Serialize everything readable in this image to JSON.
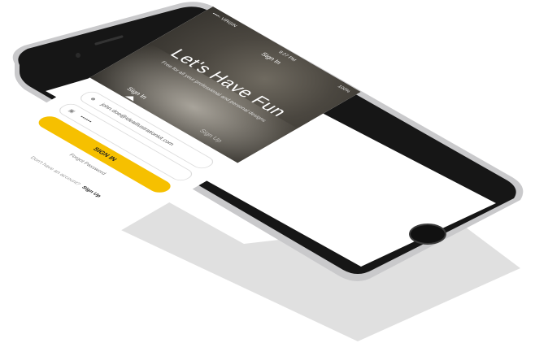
{
  "status_bar": {
    "carrier": "••••◦ VIRGIN",
    "time": "9:27 PM",
    "battery": "100%"
  },
  "nav": {
    "title": "Sign In"
  },
  "hero": {
    "headline": "Let's Have Fun",
    "subtitle": "Free for all your professional and personal designs"
  },
  "tabs": [
    {
      "label": "Sign In",
      "active": true
    },
    {
      "label": "Sign Up",
      "active": false
    }
  ],
  "form": {
    "email_value": "john.doe@ideaillustrationkit.com",
    "password_value": "••••••",
    "submit_label": "SIGN IN",
    "forgot_label": "Forgot Password",
    "no_account_label": "Don't have an account?",
    "signup_link": "Sign Up"
  },
  "icons": {
    "email": "user-icon",
    "password": "lock-icon"
  },
  "colors": {
    "accent": "#f6c000",
    "phone_body": "#1b1b1b",
    "phone_frame": "#c9c9cb"
  }
}
